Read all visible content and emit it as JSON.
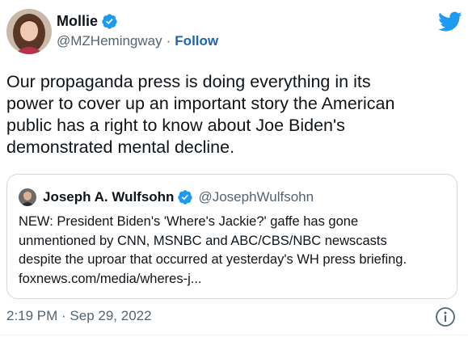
{
  "author": {
    "display_name": "Mollie",
    "handle": "@MZHemingway",
    "separator": "·",
    "follow_label": "Follow",
    "verified": true
  },
  "tweet": {
    "lines": [
      "Our propaganda press is doing everything in its",
      "power to cover up an important story the American",
      "public has a right to know about Joe Biden's",
      "demonstrated mental decline."
    ]
  },
  "quoted_tweet": {
    "display_name": "Joseph A. Wulfsohn",
    "handle": "@JosephWulfsohn",
    "verified": true,
    "lines": [
      "NEW: President Biden's 'Where's Jackie?' gaffe has gone",
      "unmentioned by CNN, MSNBC and ABC/CBS/NBC newscasts",
      "despite the uproar that occurred at yesterday's WH press briefing.",
      "foxnews.com/media/wheres-j..."
    ]
  },
  "footer": {
    "timestamp": "2:19 PM · Sep 29, 2022"
  },
  "colors": {
    "twitter_blue": "#1d9bf0",
    "follow_link": "#1d64b1",
    "secondary_text": "#536471",
    "border": "#cfd9de"
  },
  "icons": {
    "logo": "twitter-bird-icon",
    "verified": "verified-badge-icon",
    "info": "info-icon"
  }
}
